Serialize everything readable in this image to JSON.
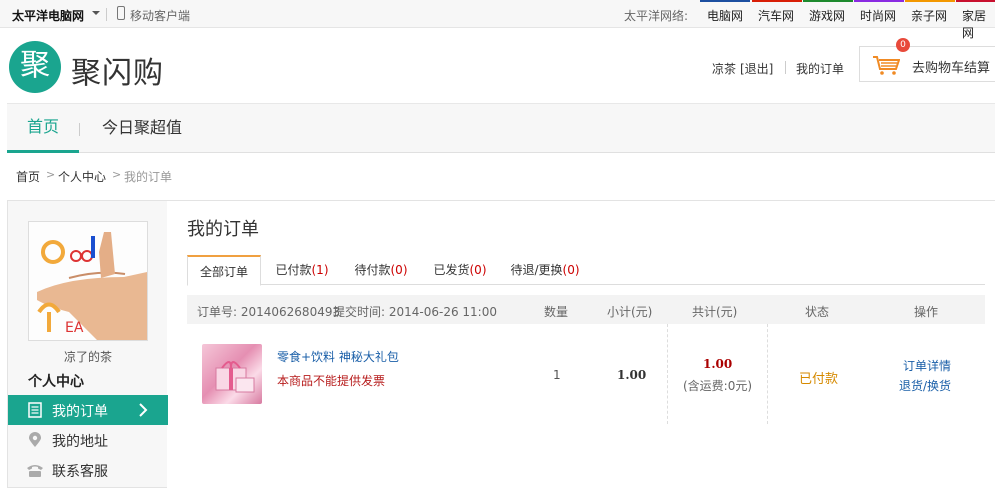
{
  "topbar": {
    "brand": "太平洋电脑网",
    "mobile": "移动客户端",
    "network_label": "太平洋网络:",
    "sites": [
      {
        "label": "电脑网",
        "color": "#1c4fa0"
      },
      {
        "label": "汽车网",
        "color": "#d81e06"
      },
      {
        "label": "游戏网",
        "color": "#1e8a2e"
      },
      {
        "label": "时尚网",
        "color": "#8a2be2"
      },
      {
        "label": "亲子网",
        "color": "#f39800"
      },
      {
        "label": "家居网",
        "color": "#c8102e"
      }
    ]
  },
  "header": {
    "logo_char": "聚",
    "logo_text": "聚闪购",
    "username": "凉茶",
    "logout": "[退出]",
    "my_orders": "我的订单",
    "cart_label": "去购物车结算",
    "cart_count": "0"
  },
  "nav": {
    "home": "首页",
    "daily": "今日聚超值"
  },
  "breadcrumb": [
    "首页",
    "个人中心",
    "我的订单"
  ],
  "sidebar": {
    "avatar_name": "凉了的茶",
    "title": "个人中心",
    "items": [
      {
        "label": "我的订单",
        "icon": "document-icon"
      },
      {
        "label": "我的地址",
        "icon": "location-pin-icon"
      },
      {
        "label": "联系客服",
        "icon": "phone-icon"
      }
    ]
  },
  "main": {
    "title": "我的订单",
    "tabs": [
      {
        "label": "全部订单",
        "count": ""
      },
      {
        "label": "已付款",
        "count": "(1)"
      },
      {
        "label": "待付款",
        "count": "(0)"
      },
      {
        "label": "已发货",
        "count": "(0)"
      },
      {
        "label": "待退/更换",
        "count": "(0)"
      }
    ],
    "header": {
      "order_no": "订单号: 2014062680493",
      "submit_time": "提交时间: 2014-06-26 11:00",
      "qty": "数量",
      "subtotal": "小计(元)",
      "total": "共计(元)",
      "status": "状态",
      "action": "操作"
    },
    "order": {
      "product": "零食+饮料 神秘大礼包",
      "note": "本商品不能提供发票",
      "qty": "1",
      "subtotal": "1.00",
      "total": "1.00",
      "shipping": "(含运费:0元)",
      "status": "已付款",
      "detail_link": "订单详情",
      "return_link": "退货/换货"
    }
  }
}
